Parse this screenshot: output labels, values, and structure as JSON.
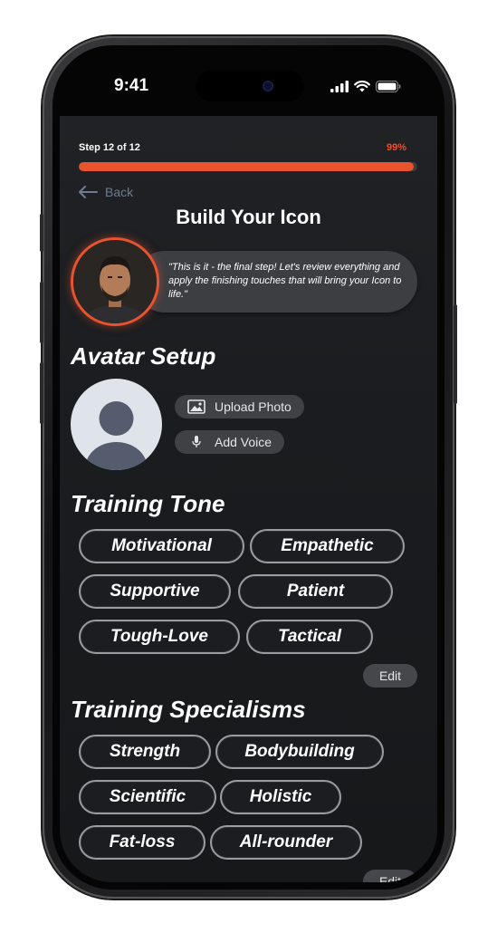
{
  "status_bar": {
    "time": "9:41"
  },
  "progress": {
    "step_label": "Step 12 of 12",
    "percent_label": "99%",
    "fraction": 0.99,
    "accent_color": "#e9542f"
  },
  "nav": {
    "back_label": "Back"
  },
  "header": {
    "title": "Build Your Icon"
  },
  "coach": {
    "message": "\"This is it - the final step! Let's review everything and apply the finishing touches that will bring your Icon to life.\""
  },
  "avatar_setup": {
    "title": "Avatar Setup",
    "upload_photo_label": "Upload Photo",
    "add_voice_label": "Add Voice"
  },
  "training_tone": {
    "title": "Training Tone",
    "chips": [
      "Motivational",
      "Empathetic",
      "Supportive",
      "Patient",
      "Tough-Love",
      "Tactical"
    ],
    "edit_label": "Edit"
  },
  "training_specialisms": {
    "title": "Training Specialisms",
    "chips": [
      "Strength",
      "Bodybuilding",
      "Scientific",
      "Holistic",
      "Fat-loss",
      "All-rounder"
    ],
    "edit_label": "Edit"
  },
  "icons": {
    "back": "arrow-left-icon",
    "upload": "image-icon",
    "voice": "microphone-icon",
    "signal": "signal-icon",
    "wifi": "wifi-icon",
    "battery": "battery-icon"
  }
}
